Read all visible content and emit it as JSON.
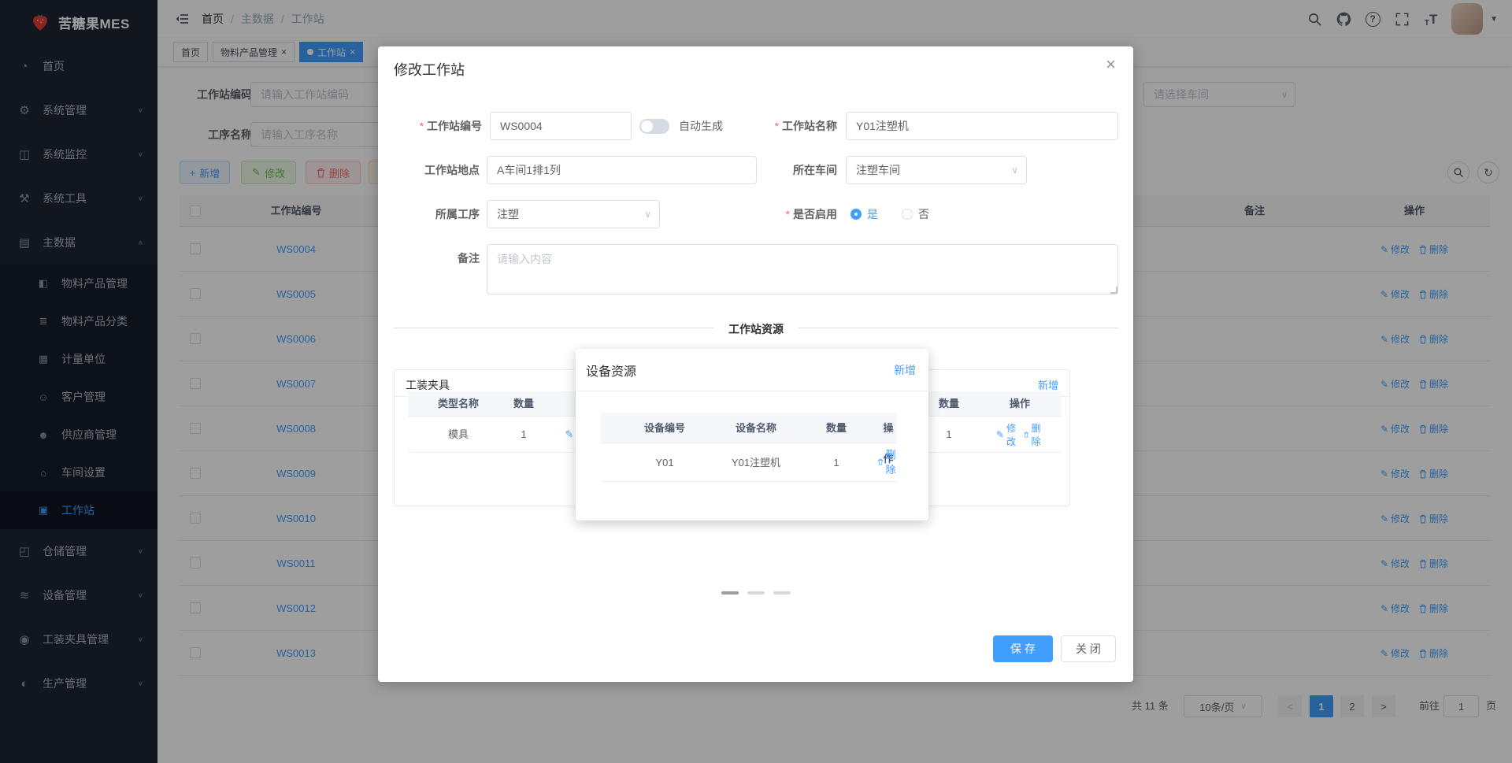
{
  "app": {
    "logo_title": "苦糖果MES"
  },
  "colors": {
    "accent": "#409eff",
    "success": "#67c23a",
    "danger": "#f56c6c",
    "warning": "#e6a23c",
    "sidebar_bg": "#1d2532",
    "mask": "rgba(0,0,0,0.38)"
  },
  "sidebar": {
    "items": [
      {
        "label": "首页",
        "icon": "dashboard-icon",
        "glyph": "◔",
        "cls": "top",
        "chev": ""
      },
      {
        "label": "系统管理",
        "icon": "gear-icon",
        "glyph": "⚙",
        "cls": "top",
        "chev": "∨"
      },
      {
        "label": "系统监控",
        "icon": "monitor-icon",
        "glyph": "◫",
        "cls": "top",
        "chev": "∨"
      },
      {
        "label": "系统工具",
        "icon": "tools-icon",
        "glyph": "⚒",
        "cls": "top",
        "chev": "∨"
      },
      {
        "label": "主数据",
        "icon": "master-data-icon",
        "glyph": "▤",
        "cls": "top",
        "chev": "∧"
      },
      {
        "label": "物料产品管理",
        "icon": "material-product-icon",
        "glyph": "◧",
        "cls": "sub",
        "chev": ""
      },
      {
        "label": "物料产品分类",
        "icon": "category-icon",
        "glyph": "≣",
        "cls": "sub",
        "chev": ""
      },
      {
        "label": "计量单位",
        "icon": "unit-icon",
        "glyph": "▦",
        "cls": "sub",
        "chev": ""
      },
      {
        "label": "客户管理",
        "icon": "customer-icon",
        "glyph": "☺",
        "cls": "sub",
        "chev": ""
      },
      {
        "label": "供应商管理",
        "icon": "supplier-icon",
        "glyph": "☻",
        "cls": "sub",
        "chev": ""
      },
      {
        "label": "车间设置",
        "icon": "workshop-icon",
        "glyph": "⌂",
        "cls": "sub",
        "chev": ""
      },
      {
        "label": "工作站",
        "icon": "workstation-icon",
        "glyph": "▣",
        "cls": "sub active",
        "chev": ""
      },
      {
        "label": "仓储管理",
        "icon": "warehouse-icon",
        "glyph": "◰",
        "cls": "top",
        "chev": "∨"
      },
      {
        "label": "设备管理",
        "icon": "equipment-icon",
        "glyph": "≋",
        "cls": "top",
        "chev": "∨"
      },
      {
        "label": "工装夹具管理",
        "icon": "fixture-icon",
        "glyph": "◉",
        "cls": "top",
        "chev": "∨"
      },
      {
        "label": "生产管理",
        "icon": "production-icon",
        "glyph": "◐",
        "cls": "top",
        "chev": "∨"
      }
    ]
  },
  "header": {
    "breadcrumb": {
      "first": "首页",
      "second": "主数据",
      "third": "工作站",
      "separator": "/"
    },
    "icons": [
      "fold-icon",
      "search-icon",
      "github-icon",
      "help-icon",
      "fullscreen-icon",
      "font-size-icon",
      "avatar",
      "caret-down-icon"
    ],
    "help_glyph": "?"
  },
  "tabs": {
    "items": [
      {
        "label": "首页",
        "cls": "no-close"
      },
      {
        "label": "物料产品管理",
        "cls": ""
      },
      {
        "label": "工作站",
        "cls": "active"
      }
    ],
    "close_glyph": "×"
  },
  "filters": {
    "code_label": "工作站编码",
    "code_placeholder": "请输入工作站编码",
    "process_label": "工序名称",
    "process_placeholder": "请输入工序名称",
    "workshop_placeholder": "请选择车间",
    "chevron": "∨"
  },
  "toolbar": {
    "add": "新增",
    "edit": "修改",
    "del": "删除",
    "add_icon": "+",
    "edit_icon": "✎",
    "refresh_glyph": "↻"
  },
  "table": {
    "col_code": "工作站编号",
    "col_remark": "备注",
    "col_action": "操作",
    "edit": "修改",
    "del": "删除",
    "rows": [
      {
        "code": "WS0004"
      },
      {
        "code": "WS0005"
      },
      {
        "code": "WS0006"
      },
      {
        "code": "WS0007"
      },
      {
        "code": "WS0008"
      },
      {
        "code": "WS0009"
      },
      {
        "code": "WS0010"
      },
      {
        "code": "WS0011"
      },
      {
        "code": "WS0012"
      },
      {
        "code": "WS0013"
      }
    ]
  },
  "pagination": {
    "total": "共 11 条",
    "size": "10条/页",
    "prev": "<",
    "next": ">",
    "pages": [
      {
        "label": "1",
        "cls": "on"
      },
      {
        "label": "2",
        "cls": ""
      }
    ],
    "goto_label": "前往",
    "goto_value": "1",
    "unit": "页",
    "chevron": "∨"
  },
  "dialog": {
    "title": "修改工作站",
    "close": "×",
    "code_label": "工作站编号",
    "code_value": "WS0004",
    "autogen_label": "自动生成",
    "name_label": "工作站名称",
    "name_value": "Y01注塑机",
    "loc_label": "工作站地点",
    "loc_value": "A车间1排1列",
    "workshop_label": "所在车间",
    "workshop_value": "注塑车间",
    "process_label": "所属工序",
    "process_value": "注塑",
    "enable_label": "是否启用",
    "enable_yes": "是",
    "enable_no": "否",
    "remark_label": "备注",
    "remark_placeholder": "请输入内容",
    "divider": "工作站资源",
    "fixture_card": {
      "title": "工装夹具",
      "col_type": "类型名称",
      "col_qty": "数量",
      "row_type": "模具",
      "row_qty": "1",
      "edit_icon": "✎"
    },
    "resource_card": {
      "add": "新增",
      "col_qty": "数量",
      "col_action": "操作",
      "row_qty": "1",
      "edit": "修改",
      "del": "删除"
    },
    "save": "保 存",
    "cancel": "关 闭",
    "chevron": "∨"
  },
  "device_popup": {
    "title": "设备资源",
    "add": "新增",
    "col_code": "设备编号",
    "col_name": "设备名称",
    "col_qty": "数量",
    "col_action": "操作",
    "rows": [
      {
        "code": "Y01",
        "name": "Y01注塑机",
        "qty": "1"
      }
    ],
    "del": "删除"
  }
}
